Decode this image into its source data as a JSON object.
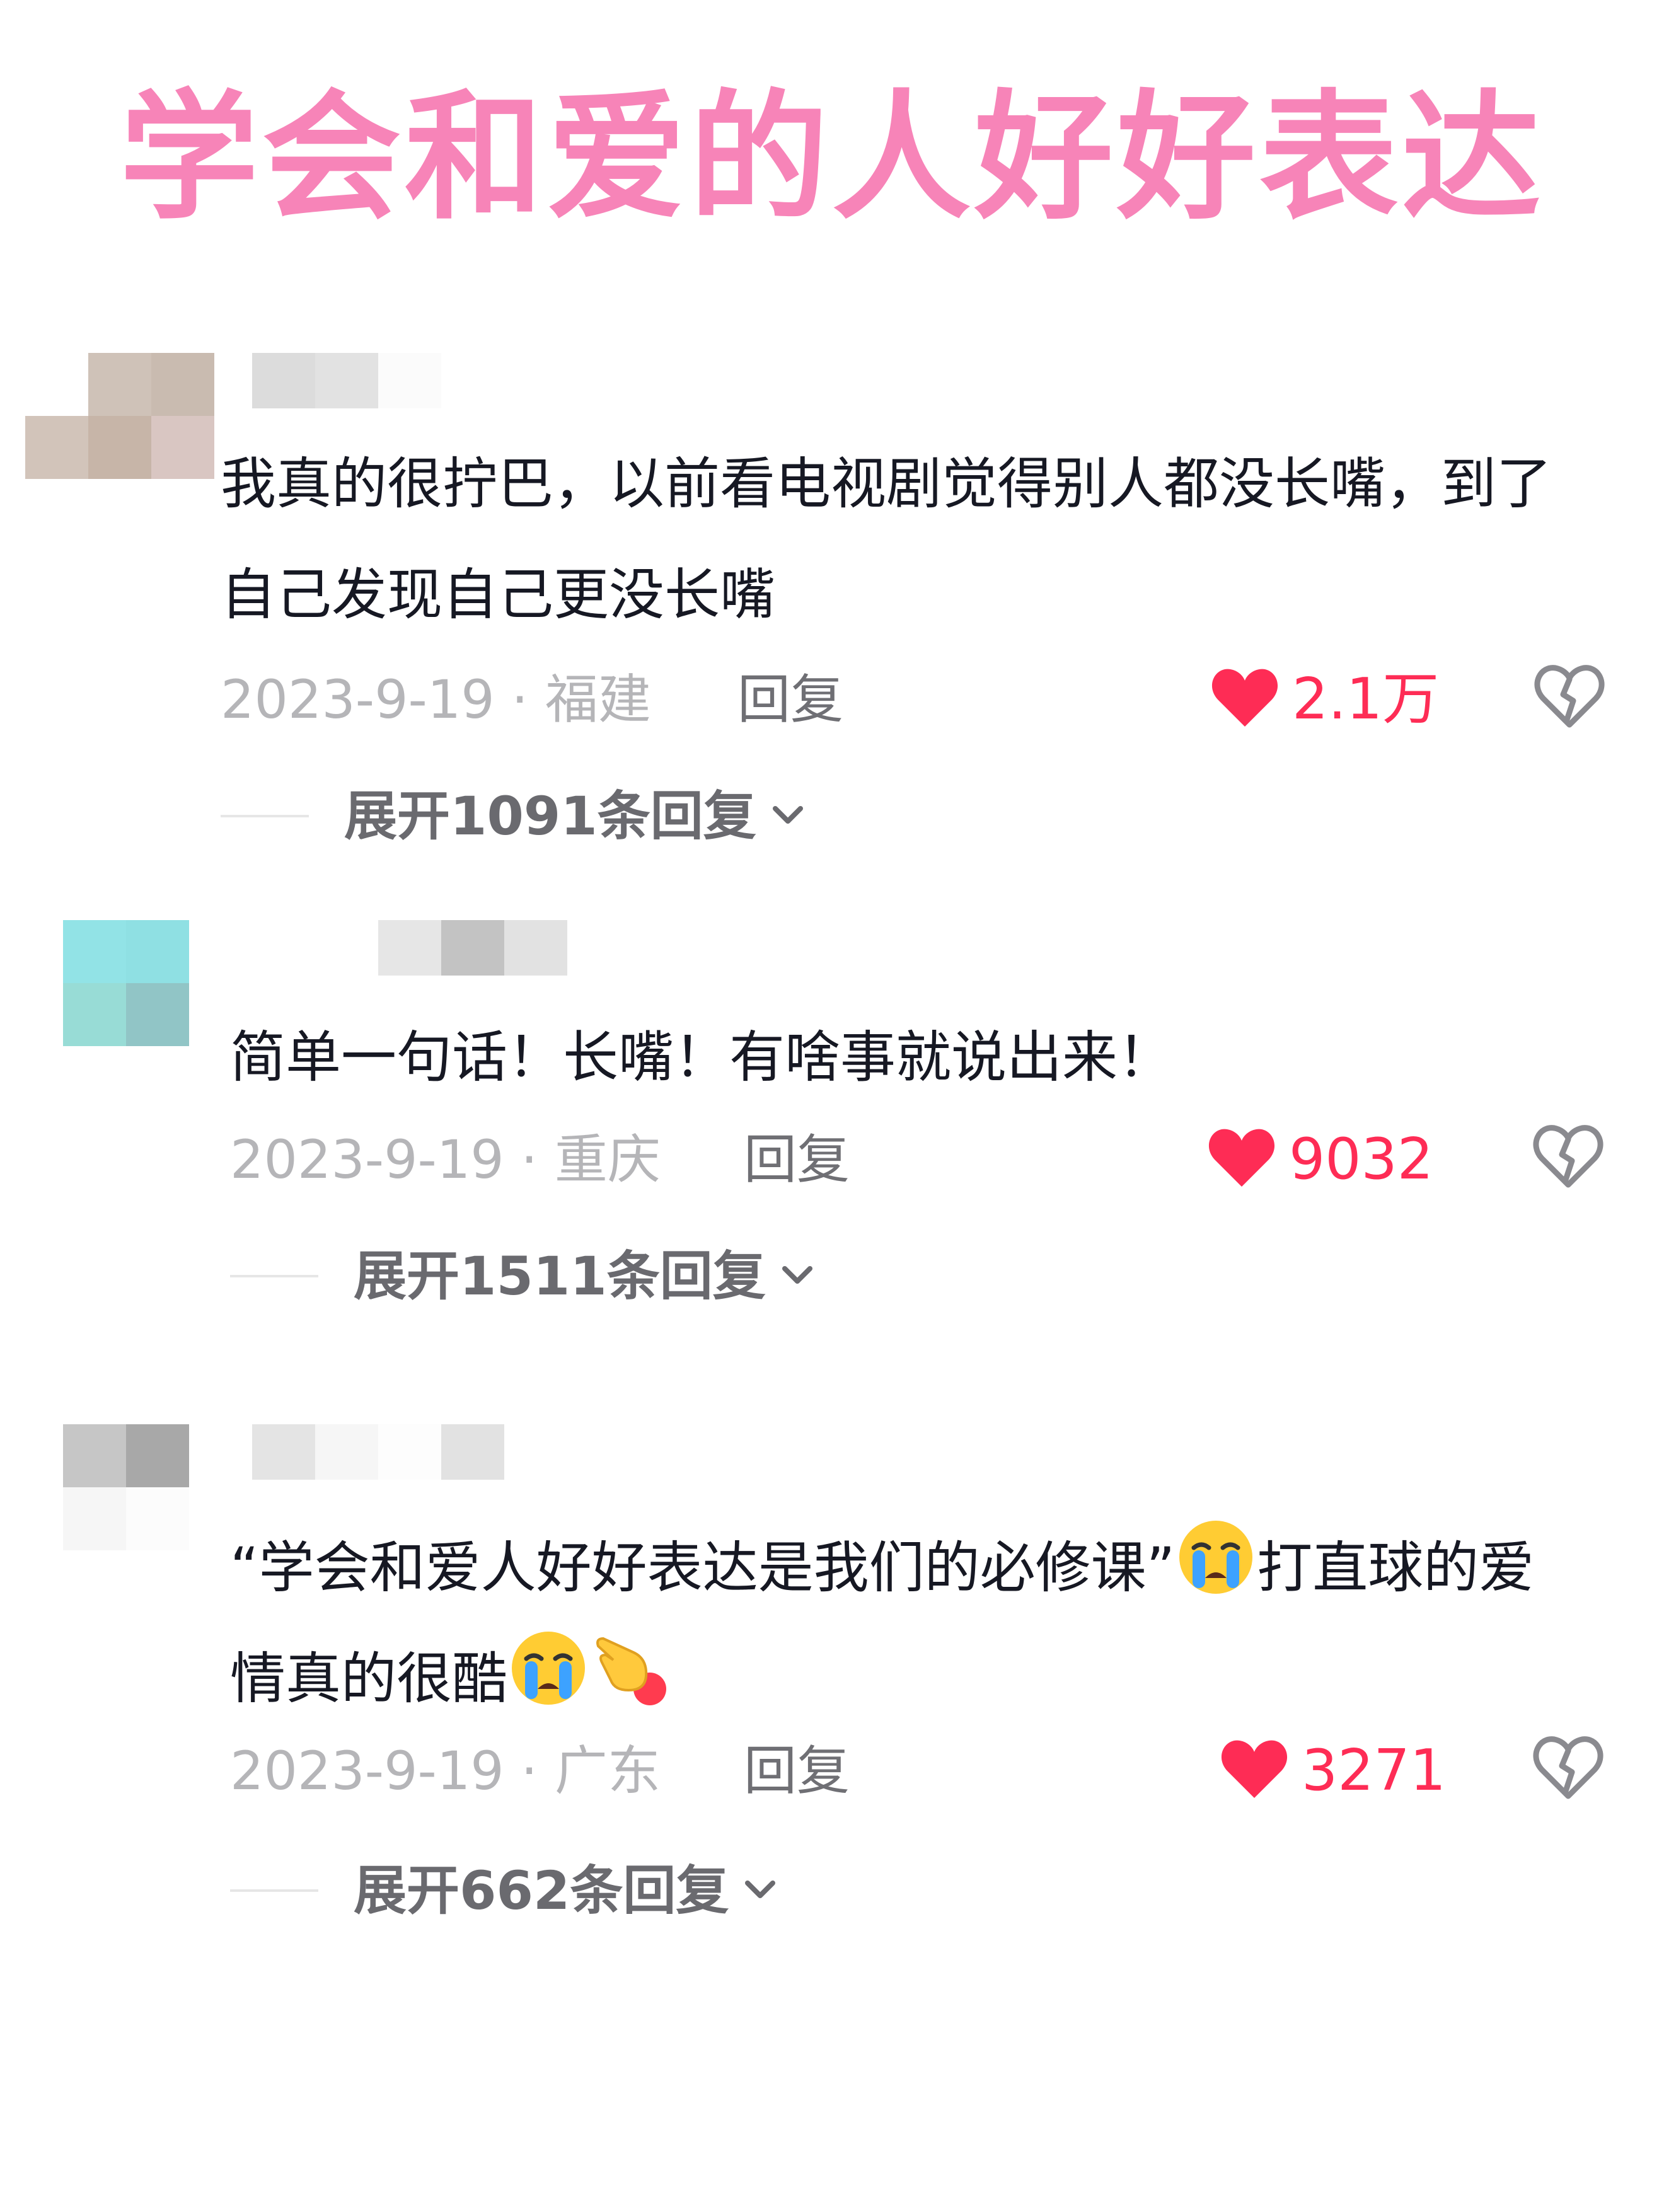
{
  "title": {
    "text": "学会和爱的人好好表达",
    "color": "#f784b8"
  },
  "comments": [
    {
      "text": "我真的很拧巴，以前看电视剧觉得别人都没长嘴，到了自己发现自己更没长嘴",
      "date": "2023-9-19",
      "location": "福建",
      "reply_label": "回复",
      "likes": "2.1万",
      "expand_label": "展开1091条回复"
    },
    {
      "text": "简单一句话！长嘴！有啥事就说出来！",
      "date": "2023-9-19",
      "location": "重庆",
      "reply_label": "回复",
      "likes": "9032",
      "expand_label": "展开1511条回复"
    },
    {
      "text_part1": "“学会和爱人好好表达是我们的必修课”",
      "text_part2": "打直球的爱情真的很酷",
      "emojis": [
        "crying-emoji",
        "crying-emoji",
        "pointing-hand-emoji"
      ],
      "date": "2023-9-19",
      "location": "广东",
      "reply_label": "回复",
      "likes": "3271",
      "expand_label": "展开662条回复"
    }
  ],
  "colors": {
    "like_red": "#fe2c55",
    "meta_gray": "#b5b5b8",
    "text_dark": "#161823"
  },
  "icons": {
    "like": "heart-icon",
    "dislike": "broken-heart-icon",
    "expand": "chevron-down-icon"
  }
}
